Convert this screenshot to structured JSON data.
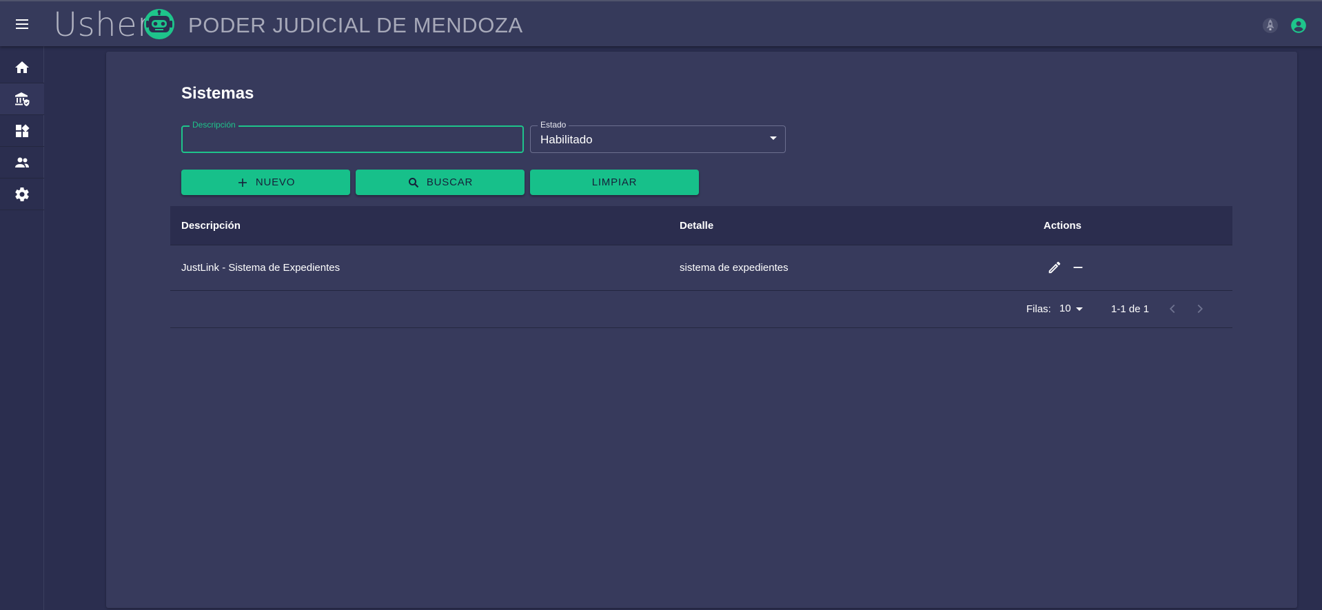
{
  "app": {
    "brand": "Usher",
    "organization": "PODER JUDICIAL DE MENDOZA"
  },
  "colors": {
    "accent": "#17c08a",
    "appbar": "#363a5b",
    "background": "#2b2e4f",
    "card": "#373a5c"
  },
  "sidebar": {
    "items": [
      {
        "icon": "home-icon"
      },
      {
        "icon": "bank-shield-icon"
      },
      {
        "icon": "dashboard-icon"
      },
      {
        "icon": "people-icon"
      },
      {
        "icon": "gear-icon"
      }
    ]
  },
  "page": {
    "title": "Sistemas"
  },
  "filters": {
    "descripcion": {
      "label": "Descripción",
      "value": ""
    },
    "estado": {
      "label": "Estado",
      "value": "Habilitado"
    }
  },
  "buttons": {
    "nuevo": "NUEVO",
    "buscar": "BUSCAR",
    "limpiar": "LIMPIAR"
  },
  "table": {
    "columns": [
      "Descripción",
      "Detalle",
      "Actions"
    ],
    "rows": [
      {
        "descripcion": "JustLink - Sistema de Expedientes",
        "detalle": "sistema de expedientes"
      }
    ],
    "footer": {
      "rows_label": "Filas:",
      "rows_per_page": "10",
      "range": "1-1 de 1"
    }
  }
}
